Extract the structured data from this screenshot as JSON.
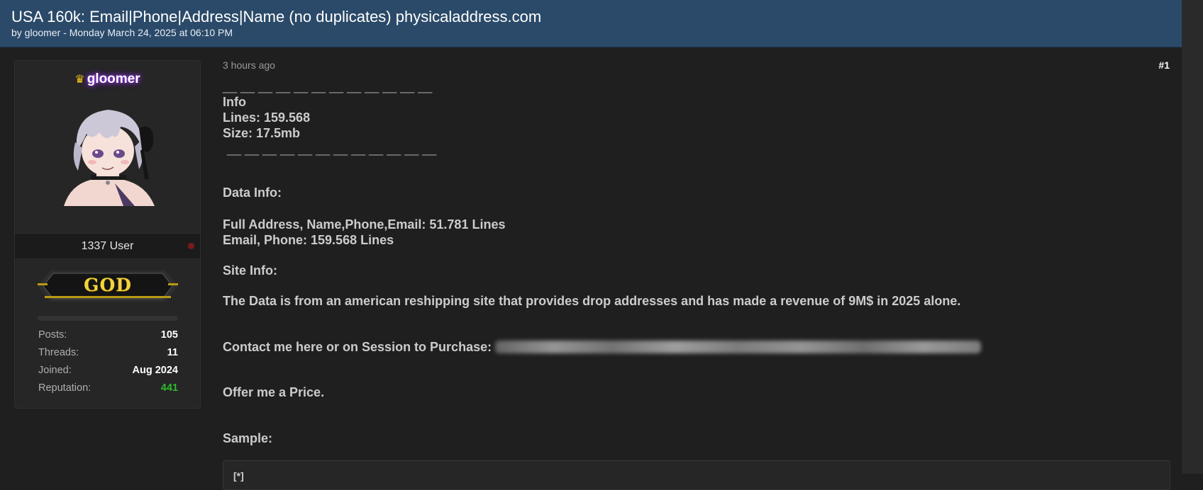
{
  "thread": {
    "title": "USA 160k: Email|Phone|Address|Name (no duplicates) physicaladdress.com",
    "byline": "by gloomer - Monday March 24, 2025 at 06:10 PM"
  },
  "user": {
    "username": "gloomer",
    "crown_icon": "crown-icon",
    "rank_title": "1337 User",
    "badge_text": "GOD",
    "stats": [
      {
        "label": "Posts:",
        "value": "105"
      },
      {
        "label": "Threads:",
        "value": "11"
      },
      {
        "label": "Joined:",
        "value": "Aug 2024"
      },
      {
        "label": "Reputation:",
        "value": "441"
      }
    ],
    "colors": {
      "reputation": "#2dbb2d",
      "username_glow": "#a43cff",
      "status_dot": "#7a1a1a"
    }
  },
  "post": {
    "time": "3 hours ago",
    "number": "#1",
    "dashes_top": "__ __ __ __ __ __ __ __ __ __ __ __",
    "info_heading": "Info",
    "lines": "Lines: 159.568",
    "size": "Size:  17.5mb",
    "dashes_bottom": "__ __ __ __ __ __ __ __ __ __ __ __",
    "data_info_heading": "Data Info:",
    "data_line_1": "Full Address, Name,Phone,Email: 51.781 Lines",
    "data_line_2": "Email, Phone: 159.568 Lines",
    "site_info_heading": "Site Info:",
    "site_info_text": "The Data is from an american reshipping site that provides drop addresses and has made a revenue of 9M$ in 2025 alone.",
    "contact_text": "Contact me here or on Session to Purchase:",
    "offer_text": "Offer me a Price.",
    "sample_heading": "Sample:",
    "code_label": "[*]"
  }
}
